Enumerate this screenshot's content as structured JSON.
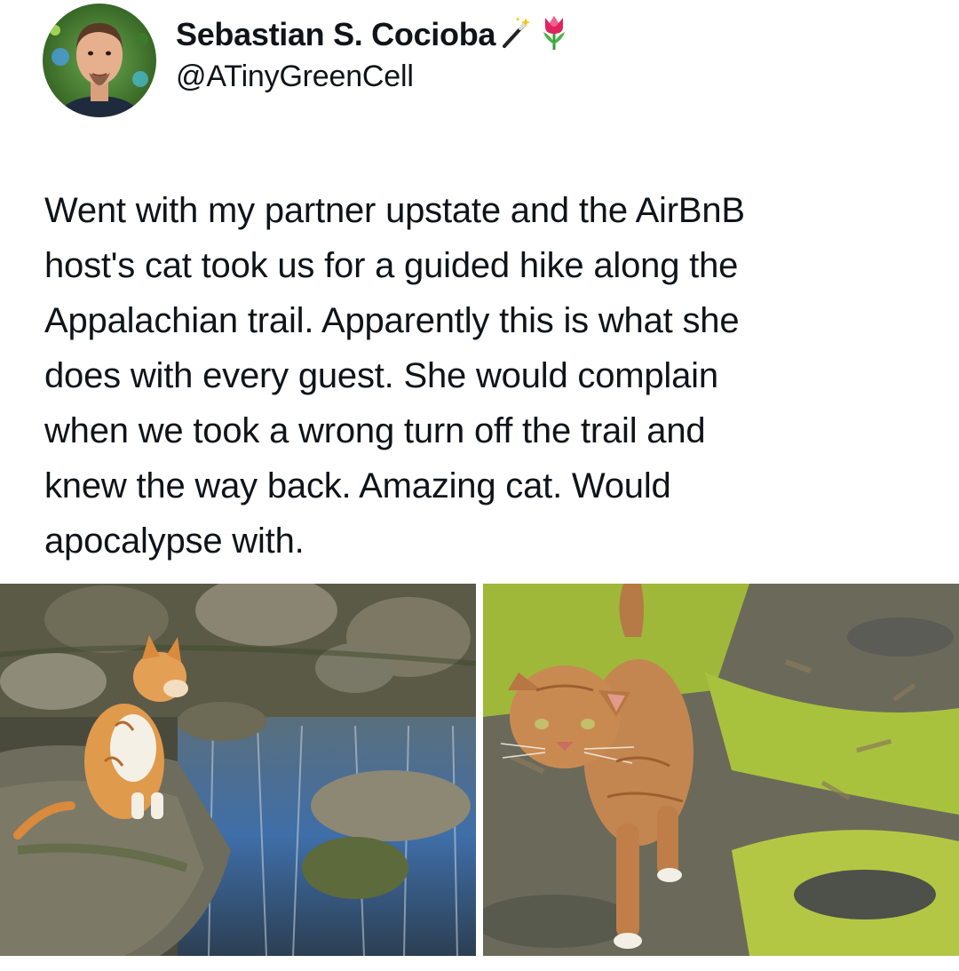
{
  "author": {
    "display_name": "Sebastian S. Cocioba",
    "handle": "@ATinyGreenCell",
    "badges": [
      "magic-wand-icon",
      "tulip-icon"
    ]
  },
  "tweet": {
    "lines": [
      "Went with my partner upstate and the AirBnB",
      "host's cat took us for a guided hike along the",
      "Appalachian trail. Apparently this is what she",
      "does with every guest. She would complain",
      "when we took a wrong turn off the trail and",
      "knew the way back. Amazing cat. Would",
      "apocalypse with."
    ]
  },
  "media": {
    "count": 2,
    "photos": [
      "photo-cat-on-rock-by-stream",
      "photo-cat-walking-on-trail"
    ]
  },
  "colors": {
    "text": "#0f1419",
    "background": "#ffffff"
  }
}
